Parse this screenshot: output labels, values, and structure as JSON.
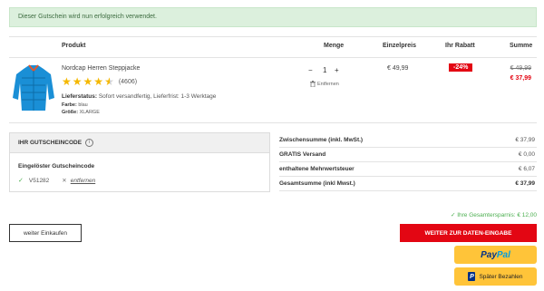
{
  "alert": {
    "message": "Dieser Gutschein wird nun erfolgreich verwendet."
  },
  "table": {
    "headers": {
      "product": "Produkt",
      "quantity": "Menge",
      "unit_price": "Einzelpreis",
      "discount": "Ihr Rabatt",
      "sum": "Summe"
    }
  },
  "item": {
    "name": "Nordcap Herren Steppjacke",
    "rating_count": "(4606)",
    "rating_stars": 4.5,
    "status_label": "Lieferstatus:",
    "status_value": "Sofort versandfertig, Lieferfrist: 1-3 Werktage",
    "color_label": "Farbe:",
    "color_value": "blau",
    "size_label": "Größe:",
    "size_value": "XLARGE",
    "qty_minus": "−",
    "qty_value": "1",
    "qty_plus": "+",
    "remove_label": "Entfernen",
    "unit_price": "€ 49,99",
    "discount": "-24%",
    "old_price": "€ 49,99",
    "new_price": "€ 37,99"
  },
  "coupon": {
    "heading": "IHR GUTSCHEINCODE",
    "info": "i",
    "redeemed_label": "Eingelöster Gutscheincode",
    "code": "V51282",
    "remove_label": "entfernen"
  },
  "totals": [
    {
      "label": "Zwischensumme (inkl. MwSt.)",
      "value": "€ 37,99"
    },
    {
      "label": "GRATIS Versand",
      "value": "€ 0,00"
    },
    {
      "label": "enthaltene Mehrwertsteuer",
      "value": "€ 6,07"
    },
    {
      "label": "Gesamtsumme (inkl Mwst.)",
      "value": "€ 37,99"
    }
  ],
  "savings": "✓ Ihre Gesamtersparnis: € 12,00",
  "buttons": {
    "continue": "weiter Einkaufen",
    "checkout": "WEITER ZUR DATEN-EINGABE",
    "paypal_1": "Pay",
    "paypal_2": "Pal",
    "pay_later": "Später Bezahlen",
    "pay_later_icon": "P"
  },
  "colors": {
    "accent": "#e30613",
    "success": "#4caf50",
    "paypal": "#ffc439",
    "star": "#f5b800"
  }
}
